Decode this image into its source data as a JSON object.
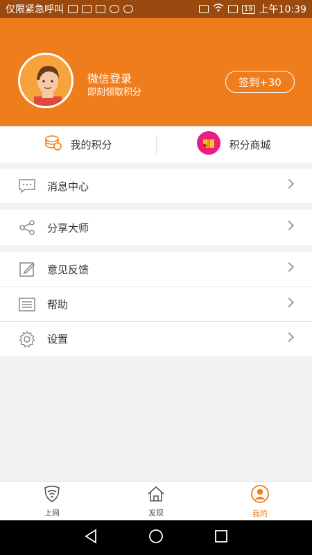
{
  "statusbar": {
    "carrier": "仅限紧急呼叫",
    "battery": "19",
    "time": "上午10:39"
  },
  "profile": {
    "login_title": "微信登录",
    "login_subtitle": "即刻领取积分",
    "checkin_label": "签到+30"
  },
  "points": {
    "my_points": "我的积分",
    "points_mall": "积分商城"
  },
  "menu": {
    "messages": "消息中心",
    "share": "分享大师",
    "feedback": "意见反馈",
    "help": "帮助",
    "settings": "设置"
  },
  "tabs": [
    {
      "label": "上网"
    },
    {
      "label": "发现"
    },
    {
      "label": "我的"
    }
  ],
  "colors": {
    "accent": "#f07d1c",
    "statusbar": "#9a4a0f"
  }
}
